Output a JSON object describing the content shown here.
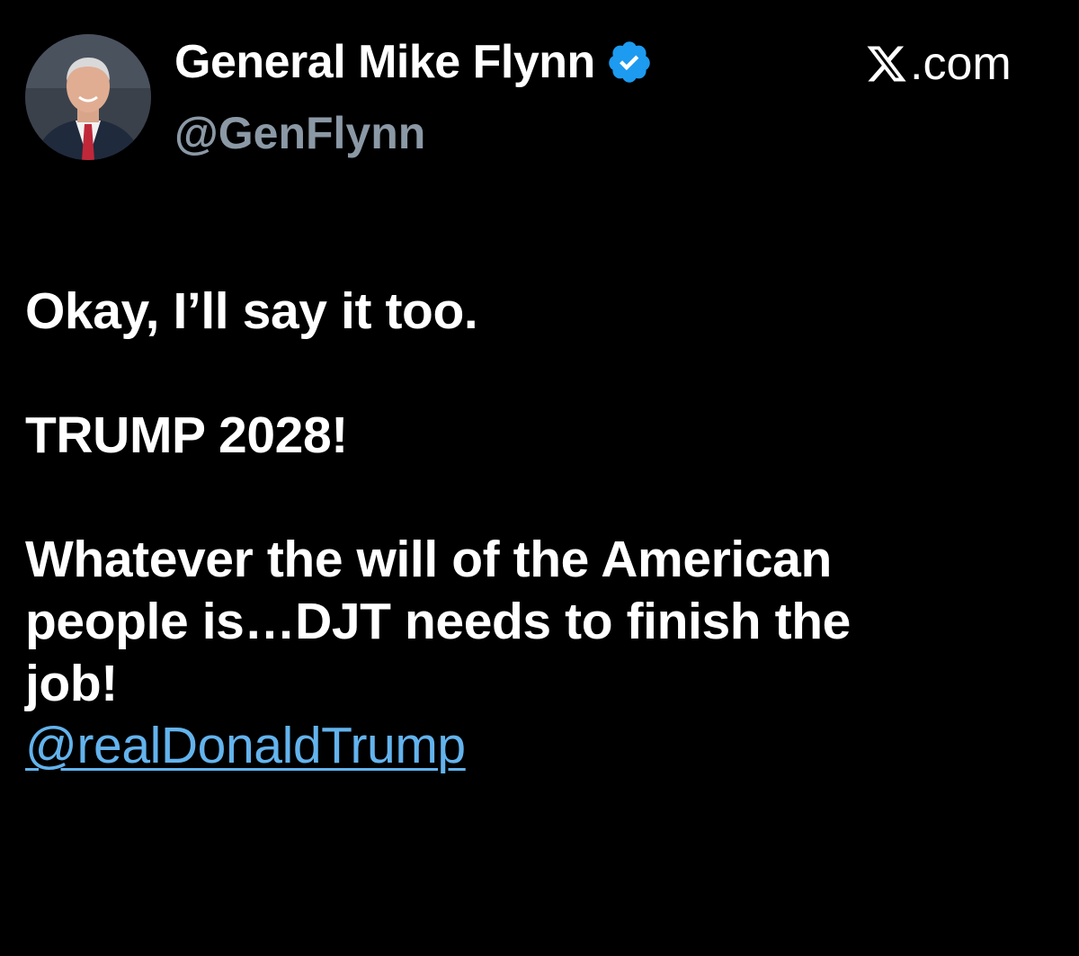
{
  "author": {
    "name": "General Mike Flynn",
    "handle": "@GenFlynn",
    "verified": true,
    "avatar_icon": "profile-photo"
  },
  "source": {
    "logo_icon": "x-logo-icon",
    "label": ".com"
  },
  "post": {
    "line1": "Okay, I’ll say it too.",
    "line2": "TRUMP 2028!",
    "line3": "Whatever the will of the American",
    "line4": "people is…DJT needs to finish the",
    "line5": "job!",
    "mention": "@realDonaldTrump"
  },
  "colors": {
    "background": "#000000",
    "text": "#ffffff",
    "handle": "#8b98a5",
    "link": "#63b3ed",
    "verified_badge": "#1d9bf0"
  }
}
